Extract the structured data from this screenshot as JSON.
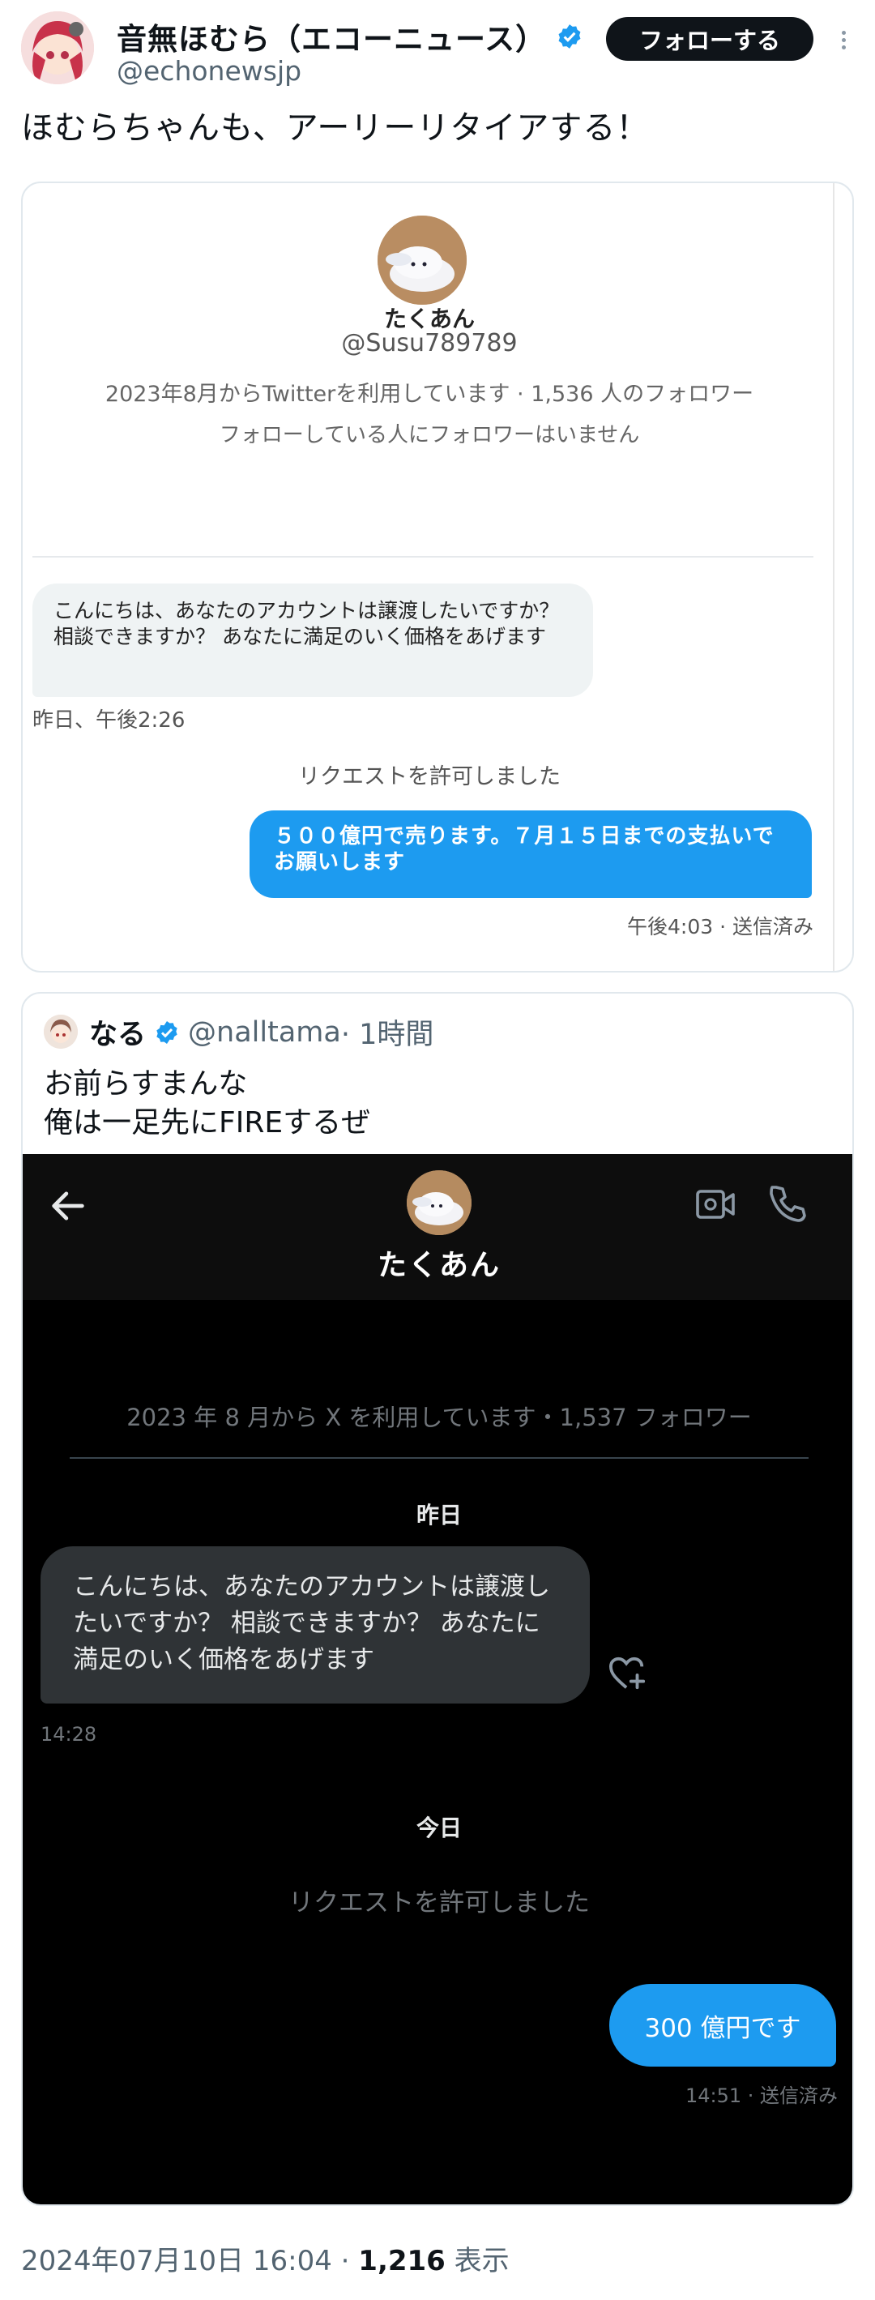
{
  "tweet": {
    "author_name": "音無ほむら（エコーニュース）",
    "author_handle": "@echonewsjp",
    "follow_label": "フォローする",
    "text": "ほむらちゃんも、アーリーリタイアする！",
    "date": "2024年07月10日 16:04",
    "separator": " · ",
    "views_count": "1,216",
    "views_label": " 表示"
  },
  "screenshot1": {
    "name": "たくあん",
    "handle": "@Susu789789",
    "info_line1": "2023年8月からTwitterを利用しています · 1,536 人のフォロワー",
    "info_line2": "フォローしている人にフォロワーはいません",
    "incoming_message": "こんにちは、あなたのアカウントは譲渡したいですか？ 相談できますか？ あなたに満足のいく価格をあげます",
    "incoming_time": "昨日、午後2:26",
    "system_message": "リクエストを許可しました",
    "outgoing_message": "５００億円で売ります。７月１５日までの支払いでお願いします",
    "outgoing_time": "午後4:03 · 送信済み"
  },
  "quoted": {
    "author_name": "なる",
    "author_handle": "@nalltama",
    "time": " · 1時間",
    "text_line1": "お前らすまんな",
    "text_line2": "俺は一足先にFIREするぜ"
  },
  "screenshot2": {
    "name": "たくあん",
    "info": "2023 年 8 月から X を利用しています・1,537 フォロワー",
    "day1": "昨日",
    "incoming_message": "こんにちは、あなたのアカウントは譲渡したいですか？ 相談できますか？ あなたに満足のいく価格をあげます",
    "incoming_time": "14:28",
    "day2": "今日",
    "system_message": "リクエストを許可しました",
    "outgoing_message": "300 億円です",
    "outgoing_time": "14:51 · 送信済み"
  },
  "colors": {
    "accent": "#1d9bf0",
    "follow_button": "#0f1419",
    "dark_bg": "#000000",
    "bubble_dark": "#2f3336"
  },
  "icons": [
    "verified-badge-icon",
    "more-icon",
    "back-arrow-icon",
    "video-call-icon",
    "phone-icon",
    "heart-plus-icon"
  ]
}
